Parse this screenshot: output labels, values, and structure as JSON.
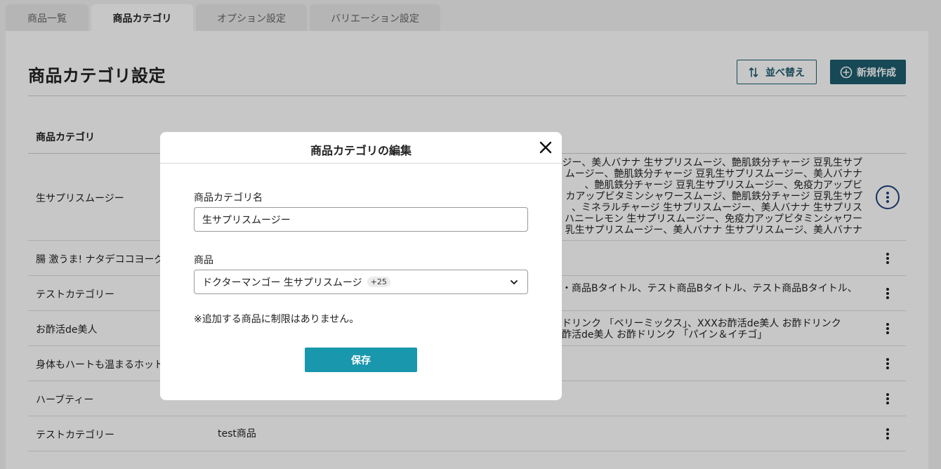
{
  "tabs": [
    "商品一覧",
    "商品カテゴリ",
    "オプション設定",
    "バリエーション設定"
  ],
  "page": {
    "title": "商品カテゴリ設定",
    "sort_label": "並べ替え",
    "new_label": "新規作成"
  },
  "table": {
    "header": "商品カテゴリ",
    "rows": [
      {
        "name": "生サプリスムージー",
        "product_lines": [
          "ジー、美人バナナ 生サプリスムージ、艶肌鉄分チャージ 豆乳生サプ",
          "ムージー、艶肌鉄分チャージ 豆乳生サプリスムージー、美人バナナ",
          "、艶肌鉄分チャージ 豆乳生サプリスムージー、免疫力アップビ",
          "カアップビタミンシャワースムージ、艶肌鉄分チャージ 豆乳生サプ",
          "、ミネラルチャージ 生サプリスムージー、美人バナナ 生サプリス",
          "ハニーレモン 生サプリスムージー、免疫力アップビタミンシャワー",
          "乳生サプリスムージー、美人バナナ 生サプリスムージ、美人バナナ"
        ]
      },
      {
        "name": "腸 激うま! ナタデココヨーグ",
        "products": ""
      },
      {
        "name": "テストカテゴリー",
        "products": "・商品Bタイトル、テスト商品Bタイトル、テスト商品Bタイトル、"
      },
      {
        "name": "お酢活de美人",
        "product_lines": [
          "ドリンク 「ベリーミックス」、XXXお酢活de美人 お酢ドリンク",
          "酢活de美人 お酢ドリンク 「パイン＆イチゴ」"
        ]
      },
      {
        "name": "身体もハートも温まるホット",
        "products": ""
      },
      {
        "name": "ハーブティー",
        "products": ""
      },
      {
        "name": "テストカテゴリー",
        "products": "test商品"
      }
    ]
  },
  "modal": {
    "title": "商品カテゴリの編集",
    "name_label": "商品カテゴリ名",
    "name_value": "生サプリスムージー",
    "product_label": "商品",
    "product_selected": "ドクターマンゴー 生サプリスムージ",
    "product_more": "+25",
    "note": "※追加する商品に制限はありません。",
    "save_label": "保存"
  },
  "colors": {
    "accent_dark": "#1d5d6e",
    "save_button": "#1997ac",
    "focus_ring": "#1d3f7c"
  }
}
